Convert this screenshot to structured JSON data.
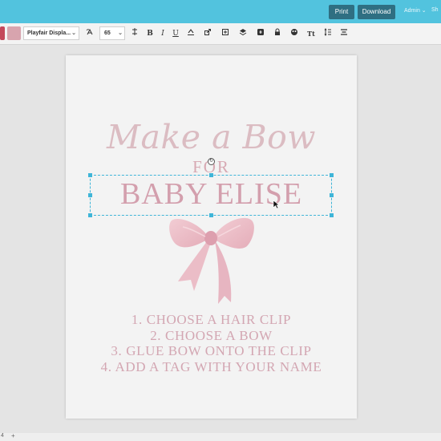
{
  "header": {
    "print_label": "Print",
    "download_label": "Download",
    "admin_label": "Admin",
    "share_label": "Sh"
  },
  "toolbar": {
    "font_name": "Playfair Displa...",
    "font_size": "65",
    "text_color": "#d8a4ae",
    "icons": [
      "text-effects-icon",
      "bold-icon",
      "italic-icon",
      "underline-icon",
      "uppercase-icon",
      "link-icon",
      "copy-icon",
      "layers-icon",
      "info-icon",
      "lock-icon",
      "color-icon",
      "text-style-icon",
      "line-height-icon",
      "align-icon"
    ]
  },
  "page": {
    "title": "Make a Bow",
    "for": "FOR",
    "name": "BABY ELISE",
    "steps": [
      "1. CHOOSE A HAIR CLIP",
      "2. CHOOSE A BOW",
      "3. GLUE BOW ONTO THE CLIP",
      "4. ADD A TAG WITH YOUR NAME"
    ]
  },
  "colors": {
    "header_bg": "#52c3de",
    "button_bg": "#2f6f82",
    "title_pink": "#dbbcc2",
    "text_pink": "#d39fad",
    "selection": "#3fb5d8"
  },
  "footer": {
    "page_indicator": "4",
    "add_label": "+"
  }
}
